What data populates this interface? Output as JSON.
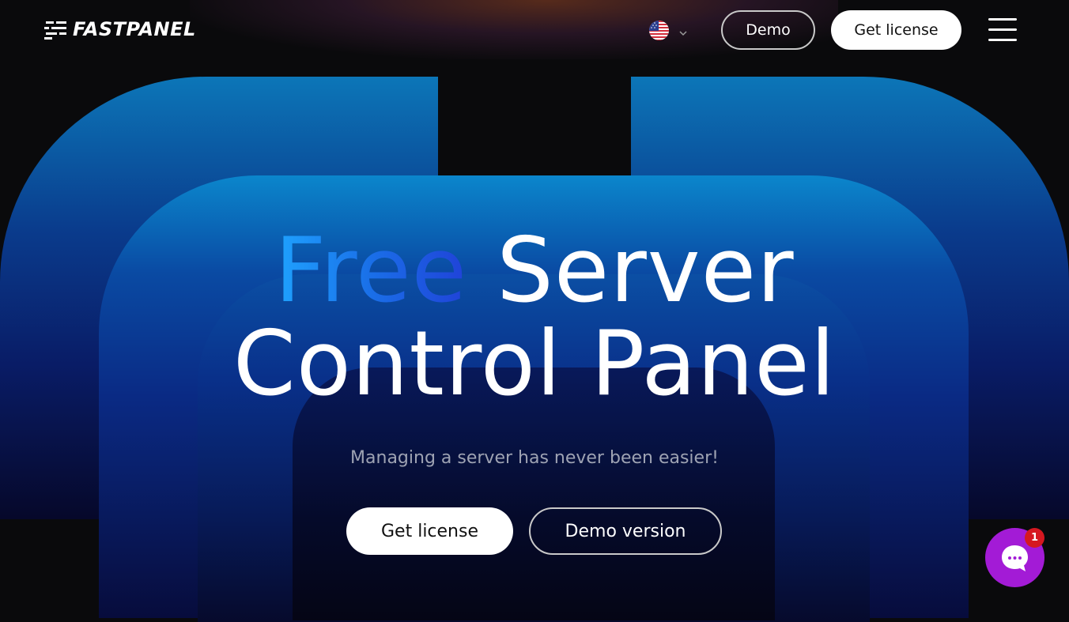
{
  "header": {
    "brand": "FASTPANEL",
    "language_flag": "us-flag-icon",
    "demo_label": "Demo",
    "license_label": "Get license",
    "menu_icon": "hamburger-icon"
  },
  "hero": {
    "title_highlight": "Free",
    "title_rest_line1": " Server",
    "title_line2": "Control Panel",
    "subtitle": "Managing a server has never been easier!",
    "primary_cta": "Get license",
    "secondary_cta": "Demo version"
  },
  "chat": {
    "icon": "chat-bubble-icon",
    "badge_count": "1"
  },
  "colors": {
    "background": "#0a0a0c",
    "accent_blue": "#1a6fe8",
    "chat_purple": "#a31bd6",
    "badge_red": "#d61820"
  }
}
